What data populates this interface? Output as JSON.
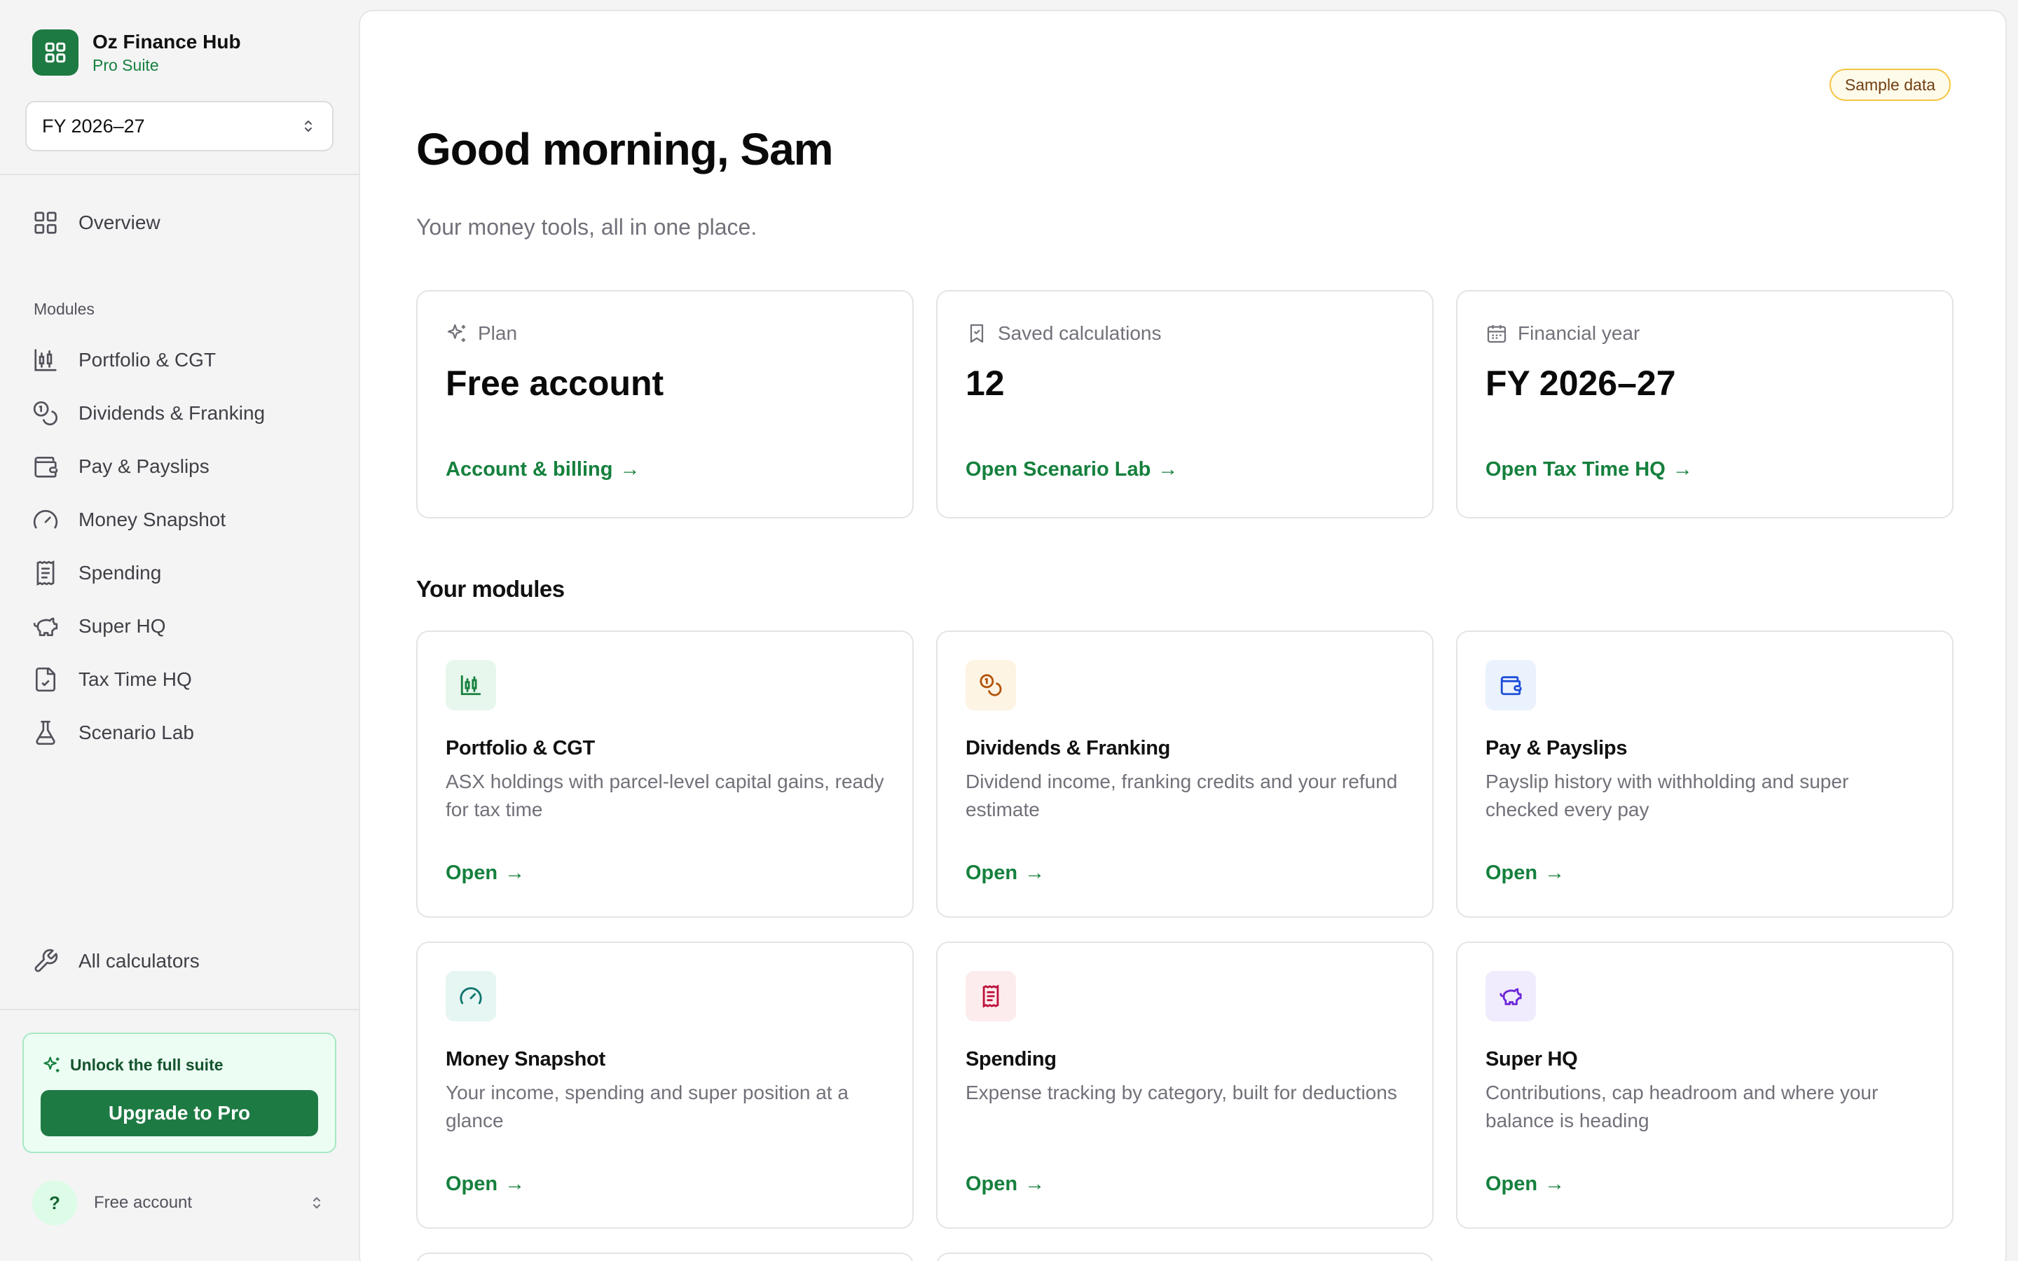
{
  "brand": {
    "name": "Oz Finance Hub",
    "tier": "Pro Suite"
  },
  "fy_selector": {
    "value": "FY 2026–27"
  },
  "nav": {
    "overview": "Overview",
    "section_label": "Modules",
    "items": [
      {
        "label": "Portfolio & CGT",
        "icon": "candlestick-chart-icon"
      },
      {
        "label": "Dividends & Franking",
        "icon": "coins-icon"
      },
      {
        "label": "Pay & Payslips",
        "icon": "wallet-icon"
      },
      {
        "label": "Money Snapshot",
        "icon": "gauge-icon"
      },
      {
        "label": "Spending",
        "icon": "receipt-icon"
      },
      {
        "label": "Super HQ",
        "icon": "piggy-bank-icon"
      },
      {
        "label": "Tax Time HQ",
        "icon": "file-icon"
      },
      {
        "label": "Scenario Lab",
        "icon": "flask-icon"
      }
    ],
    "all_calculators": "All calculators"
  },
  "upgrade": {
    "title": "Unlock the full suite",
    "button": "Upgrade to Pro"
  },
  "account": {
    "avatar": "?",
    "name": "Free account"
  },
  "header": {
    "badge": "Sample data",
    "greeting": "Good morning, Sam",
    "subtitle": "Your money tools, all in one place."
  },
  "stats": [
    {
      "label": "Plan",
      "value": "Free account",
      "link": "Account & billing",
      "icon": "sparkles-icon"
    },
    {
      "label": "Saved calculations",
      "value": "12",
      "link": "Open Scenario Lab",
      "icon": "bookmark-icon"
    },
    {
      "label": "Financial year",
      "value": "FY 2026–27",
      "link": "Open Tax Time HQ",
      "icon": "calendar-icon"
    }
  ],
  "modules_title": "Your modules",
  "modules": [
    {
      "title": "Portfolio & CGT",
      "desc": "ASX holdings with parcel-level capital gains, ready for tax time",
      "link": "Open",
      "icon": "candlestick-chart-icon",
      "color": "#15803d",
      "bg": "#e8f7ee"
    },
    {
      "title": "Dividends & Franking",
      "desc": "Dividend income, franking credits and your refund estimate",
      "link": "Open",
      "icon": "coins-icon",
      "color": "#b45309",
      "bg": "#fdf4e3"
    },
    {
      "title": "Pay & Payslips",
      "desc": "Payslip history with withholding and super checked every pay",
      "link": "Open",
      "icon": "wallet-icon",
      "color": "#1d4ed8",
      "bg": "#eaf2fd"
    },
    {
      "title": "Money Snapshot",
      "desc": "Your income, spending and super position at a glance",
      "link": "Open",
      "icon": "gauge-icon",
      "color": "#0f766e",
      "bg": "#e6f6f3"
    },
    {
      "title": "Spending",
      "desc": "Expense tracking by category, built for deductions",
      "link": "Open",
      "icon": "receipt-icon",
      "color": "#be123c",
      "bg": "#fdecee"
    },
    {
      "title": "Super HQ",
      "desc": "Contributions, cap headroom and where your balance is heading",
      "link": "Open",
      "icon": "piggy-bank-icon",
      "color": "#6d28d9",
      "bg": "#f1ecfd"
    }
  ]
}
